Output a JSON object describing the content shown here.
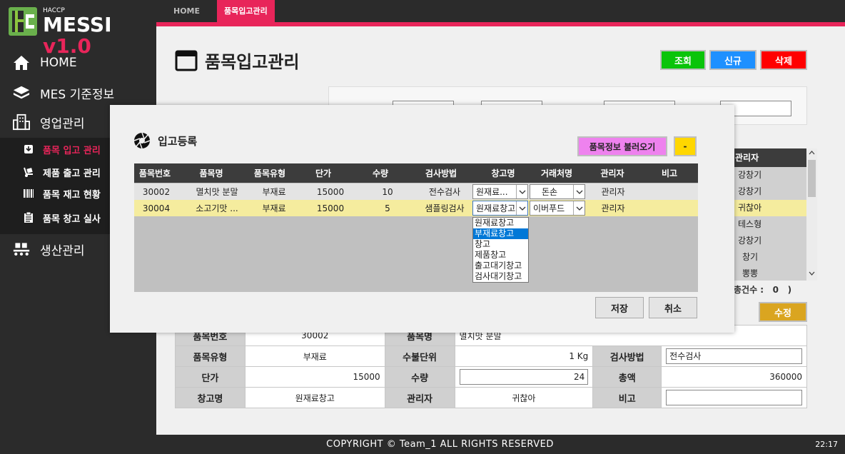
{
  "app": {
    "logo_small": "HACCP",
    "logo_title": "MESSI",
    "logo_version": "v1.0"
  },
  "sidebar": {
    "items": [
      {
        "label": "HOME",
        "icon": "home-icon"
      },
      {
        "label": "MES 기준정보",
        "icon": "layers-icon"
      },
      {
        "label": "영업관리",
        "icon": "buildings-icon"
      },
      {
        "label": "생산관리",
        "icon": "conveyor-icon"
      }
    ],
    "sub_items": [
      {
        "label": "품목 입고 관리",
        "icon": "download-box-icon",
        "active": true
      },
      {
        "label": "제품 출고 관리",
        "icon": "hand-truck-icon"
      },
      {
        "label": "품목 재고 현황",
        "icon": "barcode-icon"
      },
      {
        "label": "품목 창고 실사",
        "icon": "clipboard-icon"
      }
    ]
  },
  "topbar": {
    "tabs": [
      {
        "label": "HOME"
      },
      {
        "label": "품목입고관리",
        "active": true
      }
    ]
  },
  "main": {
    "title": "품목입고관리",
    "buttons": {
      "search": "조회",
      "new": "신규",
      "delete": "삭제",
      "edit": "수정"
    },
    "right_grid": {
      "header": "관리자",
      "rows": [
        "강창기",
        "강창기",
        "귀찮아",
        "테스형",
        "강창기",
        "창기",
        "뽕뽕"
      ],
      "selected_index": 2
    },
    "total_label": "총건수 :",
    "total_value": "0",
    "total_close": ")"
  },
  "detail": {
    "item_no_label": "품목번호",
    "item_no": "30002",
    "item_name_label": "품목명",
    "item_name": "멸치맛 분말",
    "item_type_label": "품목유형",
    "item_type": "부재료",
    "unit_label": "수불단위",
    "unit": "1 Kg",
    "inspect_label": "검사방법",
    "inspect": "전수검사",
    "price_label": "단가",
    "price": "15000",
    "qty_label": "수량",
    "qty": "24",
    "total_label": "총액",
    "total": "360000",
    "warehouse_label": "창고명",
    "warehouse": "원재료창고",
    "manager_label": "관리자",
    "manager": "귀찮아",
    "note_label": "비고",
    "note": ""
  },
  "modal": {
    "title": "입고등록",
    "load_button": "품목정보 불러오기",
    "dash_button": "-",
    "columns": [
      "품목번호",
      "품목명",
      "품목유형",
      "단가",
      "수량",
      "검사방법",
      "창고명",
      "거래처명",
      "관리자",
      "비고"
    ],
    "rows": [
      {
        "item_no": "30002",
        "item_name": "멸치맛 분말",
        "item_type": "부재료",
        "price": "15000",
        "qty": "10",
        "inspect": "전수검사",
        "warehouse": "원재료...",
        "vendor": "돈손",
        "manager": "관리자",
        "note": ""
      },
      {
        "item_no": "30004",
        "item_name": "소고기맛 ...",
        "item_type": "부재료",
        "price": "15000",
        "qty": "5",
        "inspect": "샘플링검사",
        "warehouse": "원재료창고",
        "vendor": "이버푸드",
        "manager": "관리자",
        "note": ""
      }
    ],
    "warehouse_options": [
      "원재료창고",
      "부재료창고",
      "창고",
      "제품창고",
      "출고대기창고",
      "검사대기창고"
    ],
    "highlighted_option": 1,
    "save_button": "저장",
    "cancel_button": "취소"
  },
  "footer": {
    "copyright": "COPYRIGHT © Team_1 ALL RIGHTS RESERVED",
    "clock": "22:17"
  },
  "colors": {
    "accent": "#e8255a",
    "sidebar_bg": "#2b2b2b",
    "search_btn": "#0ac40a",
    "new_btn": "#1e90ff",
    "delete_btn": "#ff0000",
    "edit_btn": "#daa520",
    "load_btn": "#ee82ee",
    "dash_btn": "#ffd700",
    "selected_row": "#f5ec9e"
  }
}
